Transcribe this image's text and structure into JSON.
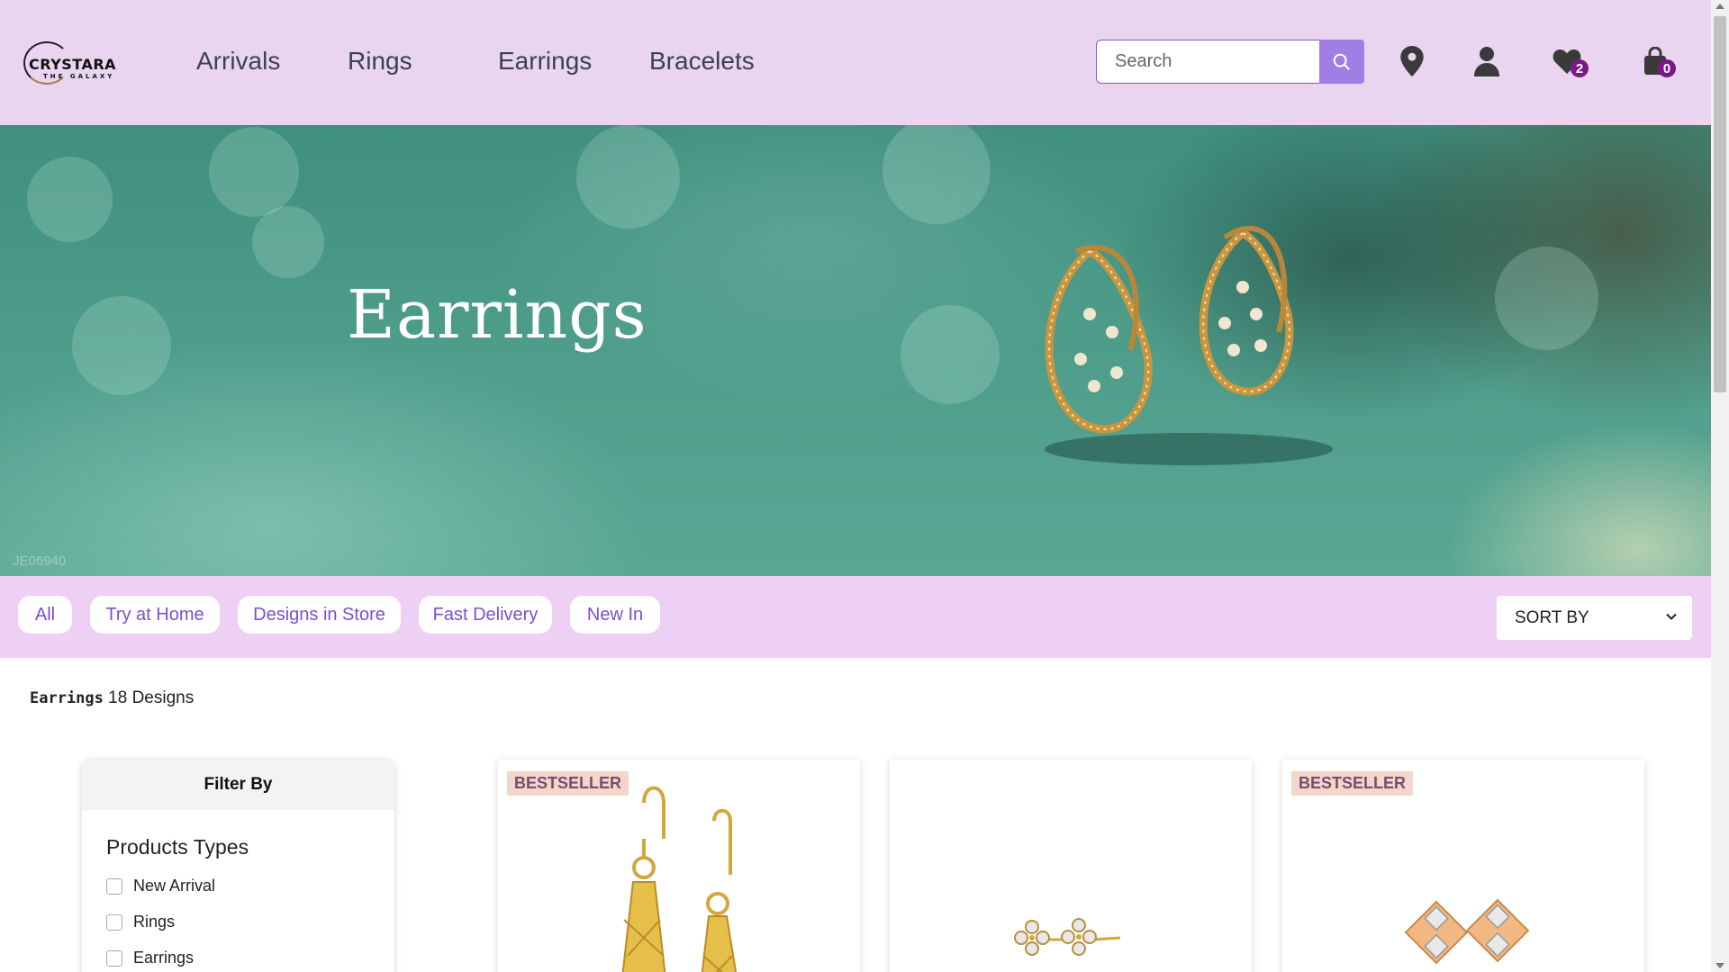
{
  "brand": {
    "name": "CRYSTARA",
    "tagline": "THE GALAXY"
  },
  "nav": [
    {
      "label": "Arrivals"
    },
    {
      "label": "Rings"
    },
    {
      "label": "Earrings"
    },
    {
      "label": "Bracelets"
    }
  ],
  "search": {
    "placeholder": "Search",
    "value": ""
  },
  "header_icons": {
    "wishlist_count": "2",
    "cart_count": "0"
  },
  "hero": {
    "title": "Earrings",
    "code": "JE06940"
  },
  "chips": [
    {
      "label": "All"
    },
    {
      "label": "Try at Home"
    },
    {
      "label": "Designs in Store"
    },
    {
      "label": "Fast Delivery"
    },
    {
      "label": "New In"
    }
  ],
  "sort": {
    "label": "SORT BY"
  },
  "listing": {
    "category": "Earrings",
    "count_text": "18 Designs"
  },
  "filter": {
    "header": "Filter By",
    "section_title": "Products Types",
    "options": [
      {
        "label": "New Arrival",
        "checked": false
      },
      {
        "label": "Rings",
        "checked": false
      },
      {
        "label": "Earrings",
        "checked": false
      }
    ]
  },
  "products": [
    {
      "badge": "BESTSELLER"
    },
    {
      "badge": ""
    },
    {
      "badge": "BESTSELLER"
    }
  ],
  "colors": {
    "header_bg": "#e9d5f0",
    "chipbar_bg": "#efd0f5",
    "accent": "#a07ee6",
    "chip_text": "#7a4fd0",
    "badge_bg": "#f3d7c9",
    "badge_text": "#7a4b73",
    "count_badge": "#7a1a86"
  }
}
